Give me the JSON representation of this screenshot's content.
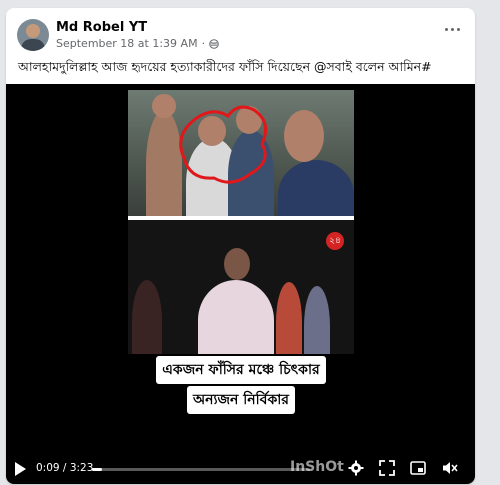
{
  "post": {
    "author": "Md Robel YT",
    "timestamp": "September 18 at 1:39 AM",
    "separator": "·",
    "caption": "আলহামদুলিল্লাহ আজ হৃদয়ের হত্যাকারীদের ফাঁসি দিয়েছেন @সবাই বলেন আমিন#"
  },
  "video": {
    "subtitle_line1": "একজন ফাঁসির মঞ্চে চিৎকার",
    "subtitle_line2": "অন্যজন নির্বিকার",
    "current_time": "0:09",
    "duration": "3:23",
    "time_separator": " / ",
    "progress_fraction": 0.045,
    "watermark": "InShOt",
    "channel_logo": "২৪"
  },
  "icons": {
    "more": "more-horizontal-icon",
    "privacy": "globe-icon",
    "play": "play-icon",
    "settings": "gear-icon",
    "fullscreen": "expand-icon",
    "pip": "picture-in-picture-icon",
    "volume": "volume-muted-icon"
  }
}
